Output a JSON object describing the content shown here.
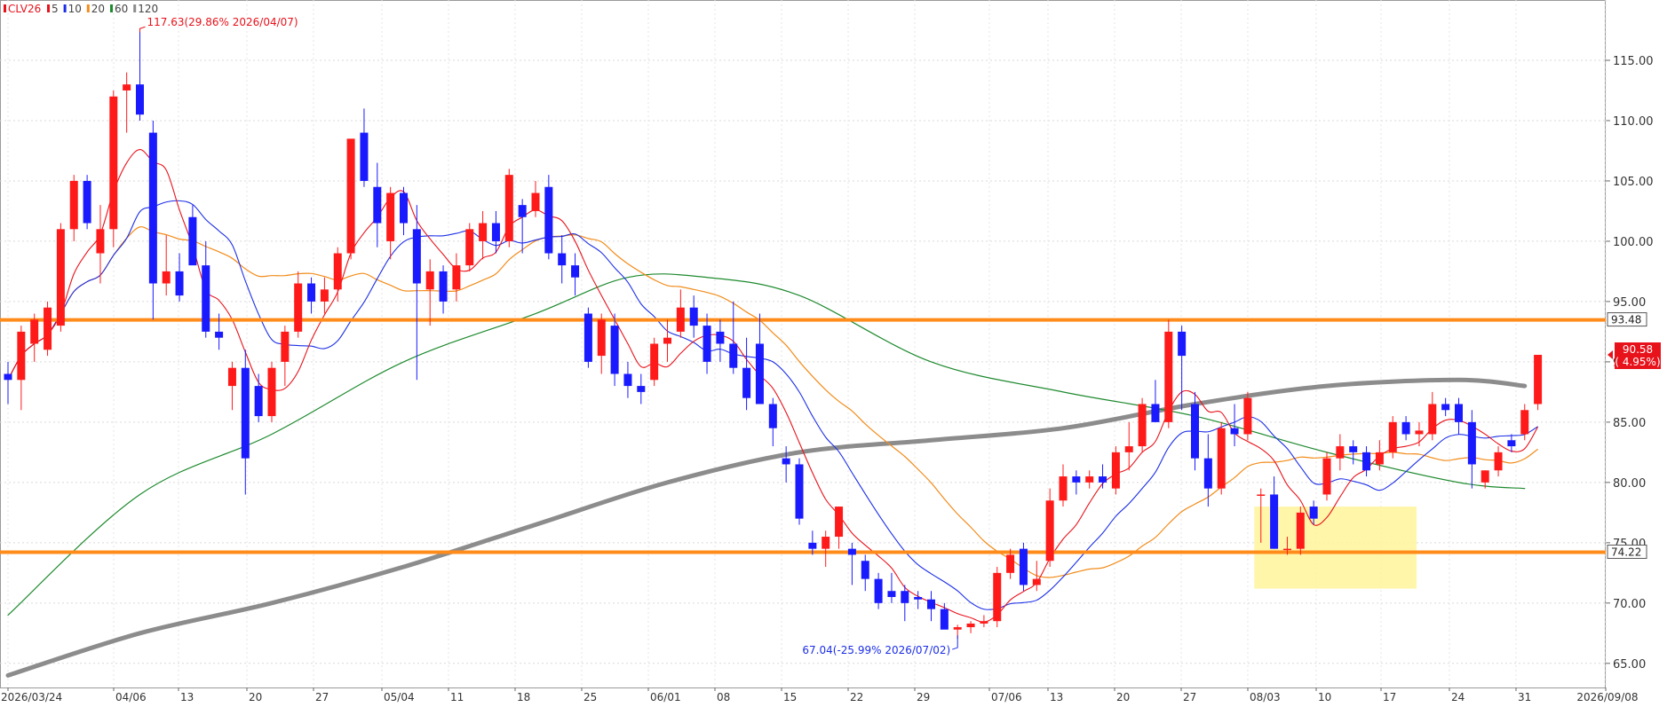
{
  "chart_data": {
    "type": "candlestick",
    "legend": {
      "items": [
        {
          "label": "CLV26",
          "color": "#e8121b"
        },
        {
          "label": "5",
          "color": "#e8121b"
        },
        {
          "label": "10",
          "color": "#1c2fe6"
        },
        {
          "label": "20",
          "color": "#f28c1b"
        },
        {
          "label": "60",
          "color": "#1e8a2e"
        },
        {
          "label": "120",
          "color": "#8c8c8c"
        }
      ]
    },
    "ylim": [
      63,
      120
    ],
    "y_ticks": [
      "65.00",
      "70.00",
      "75.00",
      "80.00",
      "85.00",
      "90.00",
      "95.00",
      "100.00",
      "105.00",
      "110.00",
      "115.00"
    ],
    "x_ticks": [
      "2026/03/24",
      "04/06",
      "13",
      "20",
      "27",
      "05/04",
      "11",
      "18",
      "25",
      "06/01",
      "08",
      "15",
      "22",
      "29",
      "07/06",
      "13",
      "20",
      "27",
      "08/03",
      "10",
      "17",
      "24",
      "31",
      "2026/09/08"
    ],
    "candles": [
      [
        89.0,
        90.0,
        86.5,
        88.5
      ],
      [
        88.5,
        93.0,
        86.0,
        92.5
      ],
      [
        91.5,
        94.0,
        90.0,
        93.5
      ],
      [
        91.0,
        95.0,
        90.5,
        94.5
      ],
      [
        93.0,
        101.5,
        92.5,
        101.0
      ],
      [
        101.0,
        105.5,
        100.0,
        105.0
      ],
      [
        105.0,
        105.5,
        101.0,
        101.5
      ],
      [
        99.0,
        103.0,
        96.5,
        101.0
      ],
      [
        101.0,
        112.5,
        99.5,
        112.0
      ],
      [
        112.5,
        114.0,
        109.0,
        113.0
      ],
      [
        113.0,
        117.6,
        110.0,
        110.5
      ],
      [
        109.0,
        110.0,
        93.5,
        96.5
      ],
      [
        96.5,
        100.5,
        95.5,
        97.5
      ],
      [
        97.5,
        99.0,
        95.0,
        95.5
      ],
      [
        102.0,
        103.0,
        98.5,
        98.0
      ],
      [
        98.0,
        100.0,
        92.0,
        92.5
      ],
      [
        92.5,
        94.0,
        91.0,
        92.0
      ],
      [
        88.0,
        90.0,
        86.0,
        89.5
      ],
      [
        89.5,
        91.0,
        79.0,
        82.0
      ],
      [
        88.0,
        89.0,
        85.0,
        85.5
      ],
      [
        85.5,
        90.0,
        85.0,
        89.5
      ],
      [
        90.0,
        93.0,
        88.0,
        92.5
      ],
      [
        92.5,
        97.5,
        92.0,
        96.5
      ],
      [
        96.5,
        97.0,
        94.0,
        95.0
      ],
      [
        95.0,
        97.0,
        94.0,
        96.0
      ],
      [
        96.0,
        99.5,
        95.0,
        99.0
      ],
      [
        99.0,
        107.0,
        98.5,
        108.5
      ],
      [
        109.0,
        111.0,
        104.5,
        105.0
      ],
      [
        104.5,
        106.5,
        99.5,
        101.5
      ],
      [
        100.0,
        104.5,
        98.5,
        104.0
      ],
      [
        104.0,
        104.5,
        100.5,
        101.5
      ],
      [
        101.0,
        103.0,
        88.5,
        96.5
      ],
      [
        96.0,
        98.5,
        93.0,
        97.5
      ],
      [
        97.5,
        98.0,
        94.0,
        95.0
      ],
      [
        96.0,
        99.0,
        95.0,
        98.0
      ],
      [
        98.0,
        101.5,
        97.5,
        101.0
      ],
      [
        100.0,
        102.5,
        98.5,
        101.5
      ],
      [
        101.5,
        102.5,
        99.0,
        100.0
      ],
      [
        100.0,
        106.0,
        99.5,
        105.5
      ],
      [
        103.0,
        103.5,
        99.0,
        102.0
      ],
      [
        102.5,
        105.0,
        102.0,
        104.0
      ],
      [
        104.5,
        105.5,
        98.5,
        99.0
      ],
      [
        99.0,
        100.5,
        96.5,
        98.0
      ],
      [
        98.0,
        99.0,
        95.5,
        97.0
      ],
      [
        94.0,
        94.5,
        89.5,
        90.0
      ],
      [
        90.5,
        94.0,
        89.0,
        93.5
      ],
      [
        93.0,
        94.0,
        88.0,
        89.0
      ],
      [
        89.0,
        90.0,
        87.0,
        88.0
      ],
      [
        88.0,
        89.0,
        86.5,
        87.5
      ],
      [
        88.5,
        92.0,
        88.0,
        91.5
      ],
      [
        91.5,
        93.5,
        90.0,
        92.0
      ],
      [
        92.5,
        96.0,
        92.0,
        94.5
      ],
      [
        94.5,
        95.5,
        92.0,
        93.0
      ],
      [
        93.0,
        94.0,
        89.0,
        90.0
      ],
      [
        92.5,
        93.5,
        90.0,
        91.5
      ],
      [
        91.5,
        95.0,
        89.0,
        89.5
      ],
      [
        89.5,
        92.0,
        86.0,
        87.0
      ],
      [
        91.5,
        94.0,
        89.0,
        86.5
      ],
      [
        86.5,
        87.0,
        83.0,
        84.5
      ],
      [
        82.0,
        83.0,
        80.0,
        81.5
      ],
      [
        81.5,
        82.0,
        76.5,
        77.0
      ],
      [
        75.0,
        76.0,
        74.0,
        74.5
      ],
      [
        74.5,
        76.0,
        73.0,
        75.5
      ],
      [
        75.5,
        78.0,
        74.5,
        78.0
      ],
      [
        74.5,
        75.0,
        71.5,
        74.0
      ],
      [
        73.5,
        74.0,
        71.0,
        72.0
      ],
      [
        72.0,
        72.5,
        69.5,
        70.0
      ],
      [
        71.0,
        72.5,
        70.0,
        70.5
      ],
      [
        71.0,
        71.5,
        68.5,
        70.0
      ],
      [
        70.5,
        71.0,
        69.5,
        70.3
      ],
      [
        70.3,
        71.0,
        68.5,
        69.5
      ],
      [
        69.5,
        70.0,
        68.0,
        67.8
      ],
      [
        67.8,
        68.2,
        67.04,
        68.0
      ],
      [
        68.0,
        68.5,
        67.5,
        68.3
      ],
      [
        68.3,
        69.0,
        68.0,
        68.5
      ],
      [
        68.5,
        73.0,
        68.0,
        72.5
      ],
      [
        72.5,
        74.5,
        72.0,
        74.0
      ],
      [
        74.5,
        75.0,
        71.0,
        71.5
      ],
      [
        71.5,
        73.5,
        71.0,
        72.0
      ],
      [
        73.5,
        79.5,
        73.0,
        78.5
      ],
      [
        78.5,
        81.5,
        78.0,
        80.5
      ],
      [
        80.5,
        81.0,
        79.0,
        80.0
      ],
      [
        80.0,
        81.0,
        79.5,
        80.5
      ],
      [
        80.5,
        81.5,
        79.5,
        80.0
      ],
      [
        79.5,
        83.0,
        79.0,
        82.5
      ],
      [
        82.5,
        85.0,
        81.0,
        83.0
      ],
      [
        83.0,
        87.0,
        82.5,
        86.5
      ],
      [
        86.5,
        88.5,
        85.0,
        85.0
      ],
      [
        85.0,
        93.5,
        84.5,
        92.5
      ],
      [
        92.5,
        93.0,
        86.0,
        90.5
      ],
      [
        86.5,
        87.5,
        81.0,
        82.0
      ],
      [
        82.0,
        84.0,
        78.0,
        79.5
      ],
      [
        79.5,
        85.0,
        79.0,
        84.5
      ],
      [
        84.5,
        86.5,
        83.0,
        84.0
      ],
      [
        84.0,
        87.5,
        83.5,
        87.0
      ],
      [
        79.0,
        79.5,
        75.0,
        79.0
      ],
      [
        79.0,
        80.5,
        74.5,
        74.5
      ],
      [
        74.5,
        75.5,
        74.0,
        74.5
      ],
      [
        74.5,
        78.0,
        74.0,
        77.5
      ],
      [
        78.0,
        78.5,
        76.5,
        77.0
      ],
      [
        79.0,
        82.5,
        78.5,
        82.0
      ],
      [
        82.0,
        84.0,
        81.0,
        83.0
      ],
      [
        83.0,
        83.5,
        81.5,
        82.5
      ],
      [
        82.5,
        83.0,
        80.5,
        81.0
      ],
      [
        81.5,
        83.5,
        81.0,
        82.5
      ],
      [
        82.5,
        85.5,
        82.0,
        85.0
      ],
      [
        85.0,
        85.5,
        83.5,
        84.0
      ],
      [
        84.0,
        85.0,
        83.0,
        84.3
      ],
      [
        84.0,
        87.5,
        83.5,
        86.5
      ],
      [
        86.5,
        87.0,
        85.5,
        86.0
      ],
      [
        86.5,
        87.0,
        84.0,
        85.0
      ],
      [
        85.0,
        86.0,
        79.5,
        81.5
      ],
      [
        80.0,
        81.0,
        79.5,
        81.0
      ],
      [
        81.0,
        83.0,
        80.5,
        82.5
      ],
      [
        83.5,
        84.0,
        82.5,
        83.0
      ],
      [
        84.0,
        86.5,
        83.5,
        86.0
      ],
      [
        86.5,
        90.5,
        86.0,
        90.58
      ]
    ],
    "horizontal_lines": [
      {
        "value": 93.48,
        "label": "93.48",
        "color": "#ff8c1a"
      },
      {
        "value": 74.22,
        "label": "74.22",
        "color": "#ff8c1a"
      }
    ],
    "current_price": {
      "value": 90.58,
      "label": "90.58",
      "change": "( 4.95%)",
      "color": "#e8121b"
    },
    "high_annotation": {
      "text": "117.63(29.86% 2026/04/07)",
      "value": 117.63,
      "index": 10,
      "color": "#e8121b"
    },
    "low_annotation": {
      "text": "67.04(-25.99% 2026/07/02)",
      "value": 67.04,
      "index": 72,
      "color": "#1c2fe6"
    },
    "highlight_box": {
      "x_start_index": 94.5,
      "x_end_index": 106.8,
      "y_top": 78.0,
      "y_bottom": 71.2,
      "color": "#fff59a"
    },
    "ma_120": {
      "x": [
        0,
        10,
        20,
        30,
        40,
        50,
        60,
        70,
        80,
        90,
        100,
        110,
        115
      ],
      "y": [
        64.0,
        67.5,
        70.0,
        73.0,
        76.5,
        80.0,
        82.5,
        83.5,
        84.5,
        86.5,
        88.0,
        88.5,
        88.0
      ],
      "color": "#8c8c8c"
    },
    "ma_60": {
      "x": [
        0,
        10,
        20,
        30,
        40,
        47,
        53,
        60,
        70,
        80,
        90,
        100,
        110,
        115
      ],
      "y": [
        69.0,
        79.0,
        84.0,
        90.0,
        94.0,
        97.0,
        97.0,
        95.5,
        90.0,
        87.5,
        85.5,
        82.5,
        80.0,
        79.5
      ],
      "color": "#1e8a2e"
    }
  }
}
